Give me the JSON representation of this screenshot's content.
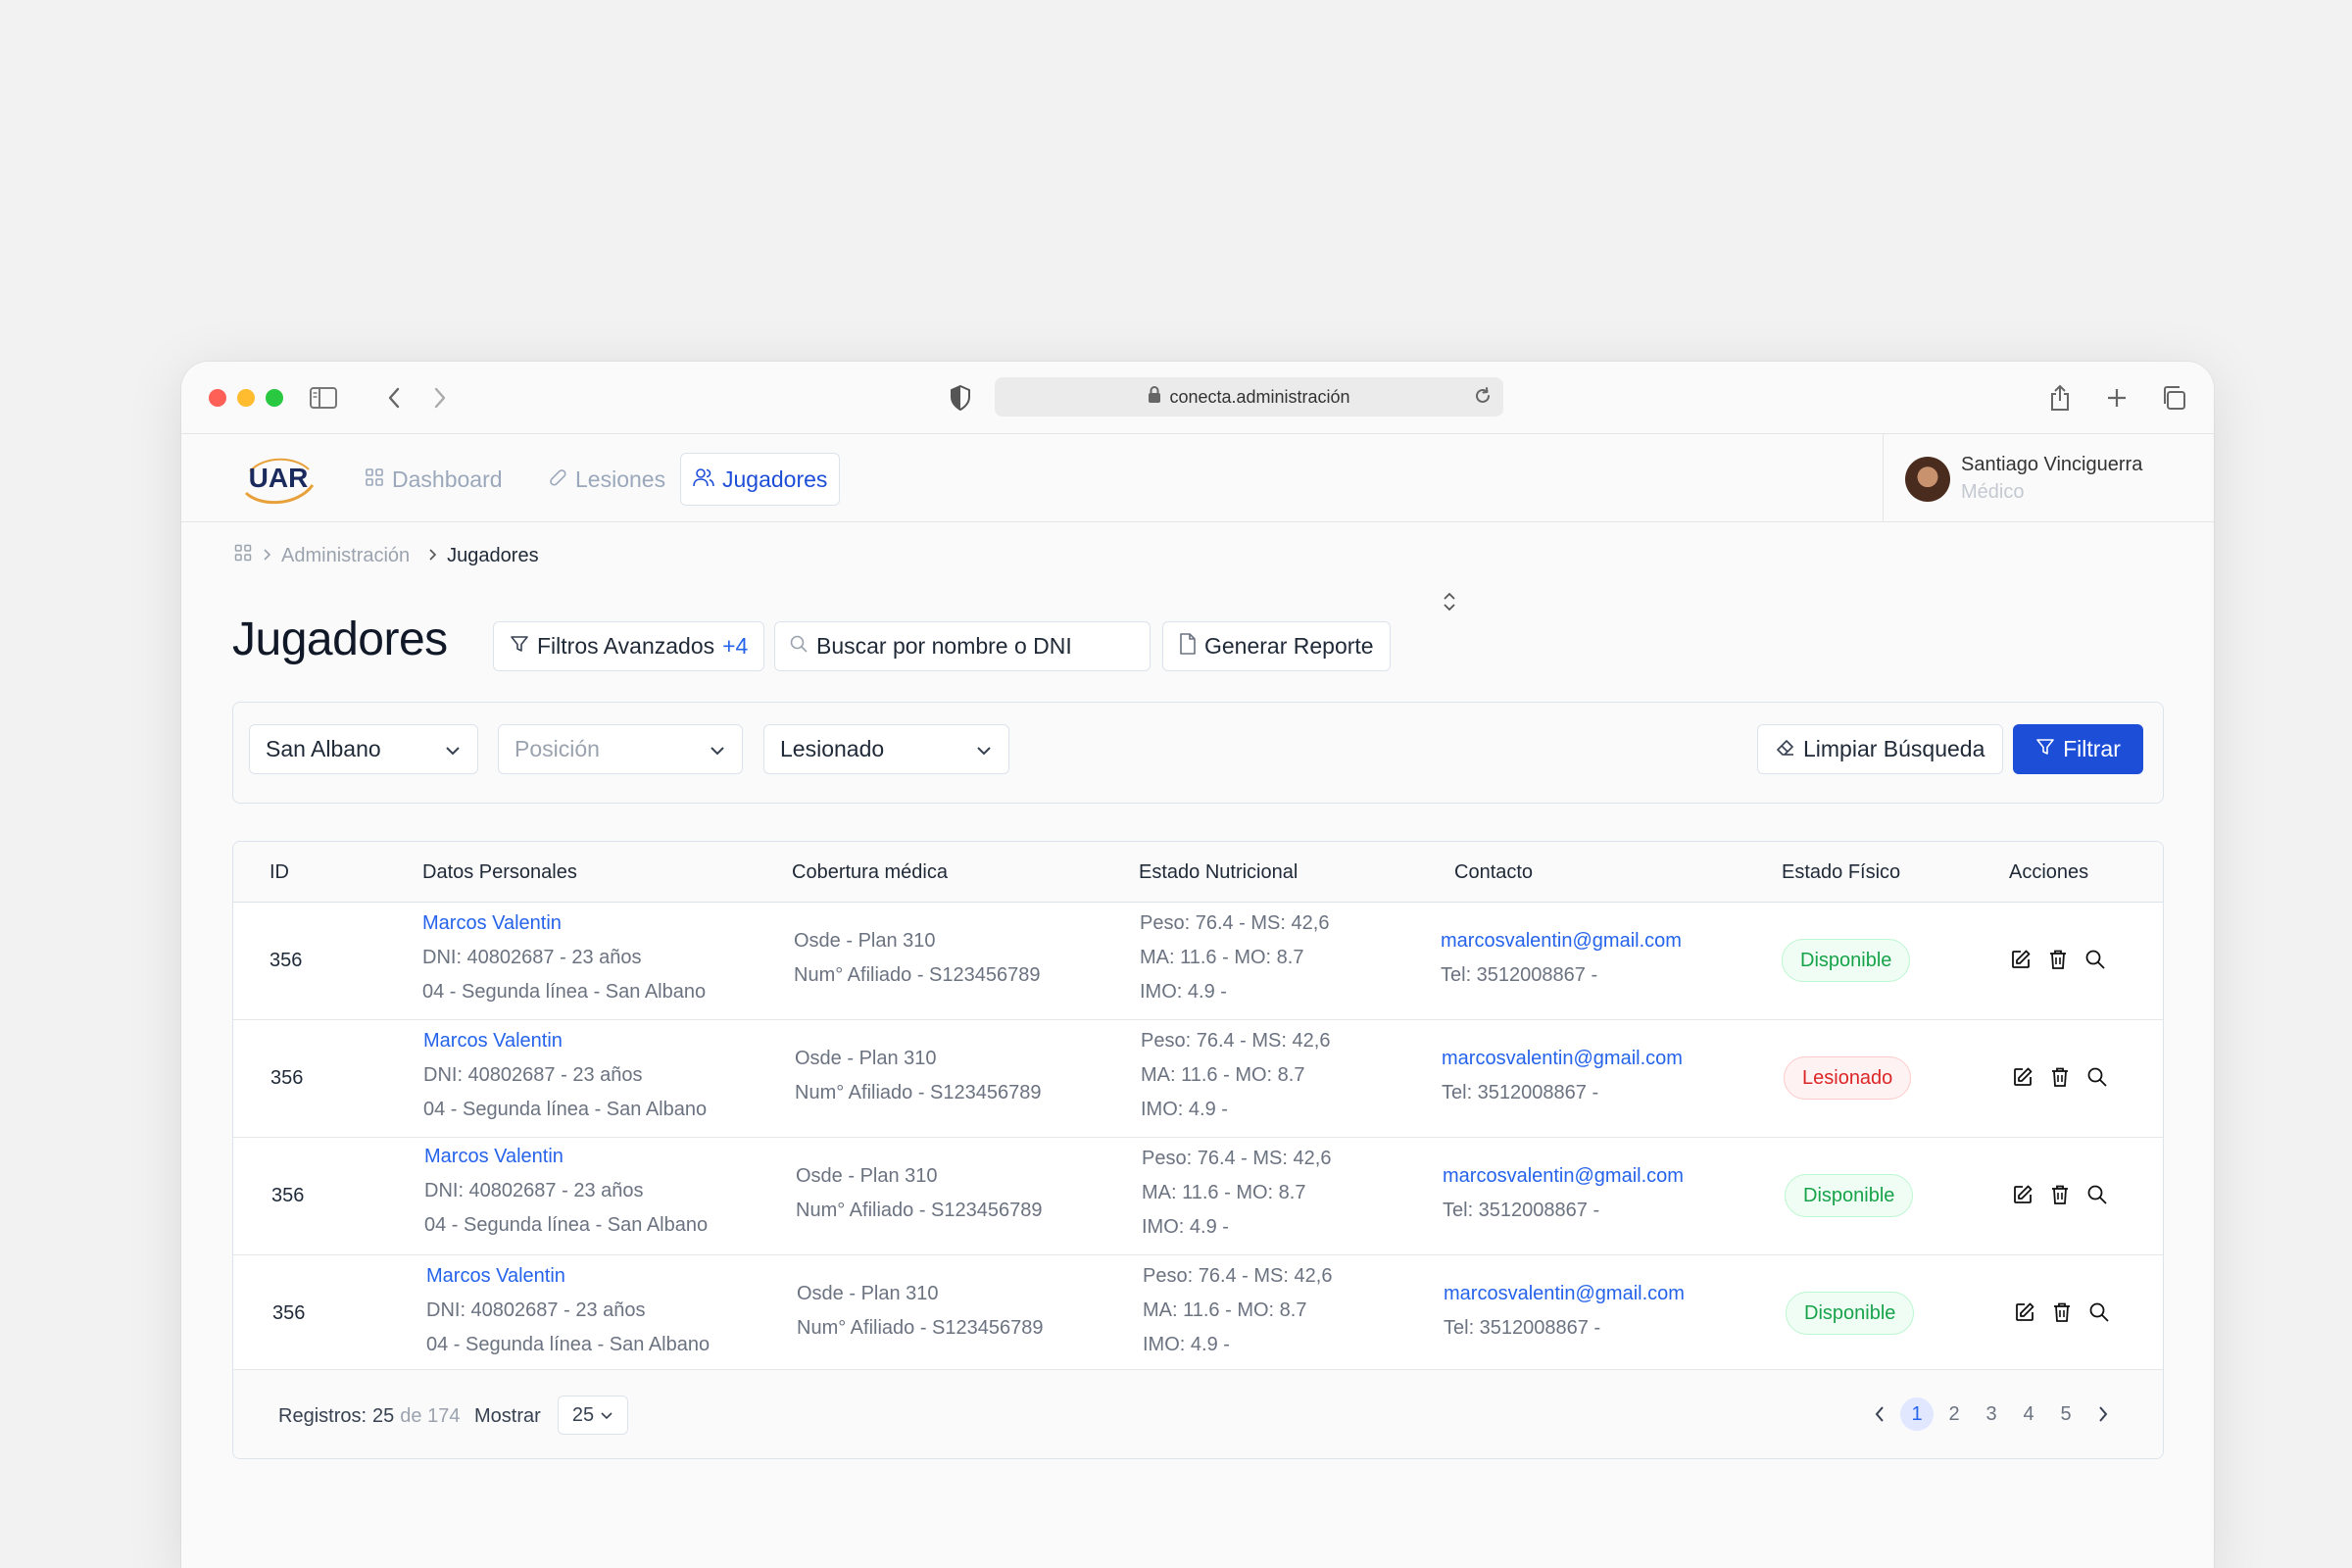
{
  "browser": {
    "url": "conecta.administración"
  },
  "nav": {
    "logo_text": "UAR",
    "items": [
      {
        "label": "Dashboard"
      },
      {
        "label": "Lesiones"
      },
      {
        "label": "Jugadores"
      }
    ],
    "active_index": 2
  },
  "user": {
    "name": "Santiago Vinciguerra",
    "role": "Médico"
  },
  "breadcrumb": {
    "parent": "Administración",
    "current": "Jugadores"
  },
  "page": {
    "title": "Jugadores"
  },
  "toolbar": {
    "filters_label": "Filtros Avanzados",
    "filters_count": "+4",
    "search_placeholder": "Buscar por nombre o DNI",
    "report_label": "Generar Reporte"
  },
  "filters": {
    "club": "San Albano",
    "position_placeholder": "Posición",
    "status": "Lesionado",
    "clear_label": "Limpiar Búsqueda",
    "apply_label": "Filtrar"
  },
  "table": {
    "headers": [
      "ID",
      "Datos Personales",
      "Cobertura médica",
      "Estado Nutricional",
      "Contacto",
      "Estado Físico",
      "Acciones"
    ],
    "rows": [
      {
        "id": "356",
        "name": "Marcos Valentin",
        "dni": "DNI: 40802687 - 23 años",
        "team": "04 - Segunda línea - San Albano",
        "coverage_plan": "Osde  - Plan 310",
        "coverage_member": "Num° Afiliado - S123456789",
        "nutri_1": "Peso: 76.4 - MS: 42,6",
        "nutri_2": "MA: 11.6 - MO: 8.7",
        "nutri_3": "IMO: 4.9 -",
        "email": "marcosvalentin@gmail.com",
        "phone": "Tel: 3512008867 -",
        "status": "Disponible",
        "status_kind": "ok"
      },
      {
        "id": "356",
        "name": "Marcos Valentin",
        "dni": "DNI: 40802687 - 23 años",
        "team": "04 - Segunda línea - San Albano",
        "coverage_plan": "Osde  - Plan 310",
        "coverage_member": "Num° Afiliado - S123456789",
        "nutri_1": "Peso: 76.4 - MS: 42,6",
        "nutri_2": "MA: 11.6 - MO: 8.7",
        "nutri_3": "IMO: 4.9 -",
        "email": "marcosvalentin@gmail.com",
        "phone": "Tel: 3512008867 -",
        "status": "Lesionado",
        "status_kind": "bad"
      },
      {
        "id": "356",
        "name": "Marcos Valentin",
        "dni": "DNI: 40802687 - 23 años",
        "team": "04 - Segunda línea - San Albano",
        "coverage_plan": "Osde  - Plan 310",
        "coverage_member": "Num° Afiliado - S123456789",
        "nutri_1": "Peso: 76.4 - MS: 42,6",
        "nutri_2": "MA: 11.6 - MO: 8.7",
        "nutri_3": "IMO: 4.9 -",
        "email": "marcosvalentin@gmail.com",
        "phone": "Tel: 3512008867 -",
        "status": "Disponible",
        "status_kind": "ok"
      },
      {
        "id": "356",
        "name": "Marcos Valentin",
        "dni": "DNI: 40802687 - 23 años",
        "team": "04 - Segunda línea - San Albano",
        "coverage_plan": "Osde  - Plan 310",
        "coverage_member": "Num° Afiliado - S123456789",
        "nutri_1": "Peso: 76.4 - MS: 42,6",
        "nutri_2": "MA: 11.6 - MO: 8.7",
        "nutri_3": "IMO: 4.9 -",
        "email": "marcosvalentin@gmail.com",
        "phone": "Tel: 3512008867 -",
        "status": "Disponible",
        "status_kind": "ok"
      }
    ]
  },
  "footer": {
    "records_label": "Registros:",
    "records_shown": "25",
    "records_total": "de 174",
    "show_label": "Mostrar",
    "page_size": "25",
    "pages": [
      "1",
      "2",
      "3",
      "4",
      "5"
    ],
    "current_page": "1"
  },
  "colors": {
    "primary": "#1d4ed8",
    "link": "#2563eb",
    "ok": "#16a34a",
    "bad": "#dc2626"
  },
  "icons": [
    "sidebar-icon",
    "back-icon",
    "forward-icon",
    "shield-icon",
    "lock-icon",
    "reload-icon",
    "share-icon",
    "plus-icon",
    "tabs-icon",
    "grid-icon",
    "band-aid-icon",
    "users-icon",
    "filter-icon",
    "search-icon",
    "document-icon",
    "sort-icon",
    "chevron-down-icon",
    "eraser-icon",
    "edit-icon",
    "trash-icon",
    "zoom-icon",
    "chevron-left-icon",
    "chevron-right-icon"
  ]
}
